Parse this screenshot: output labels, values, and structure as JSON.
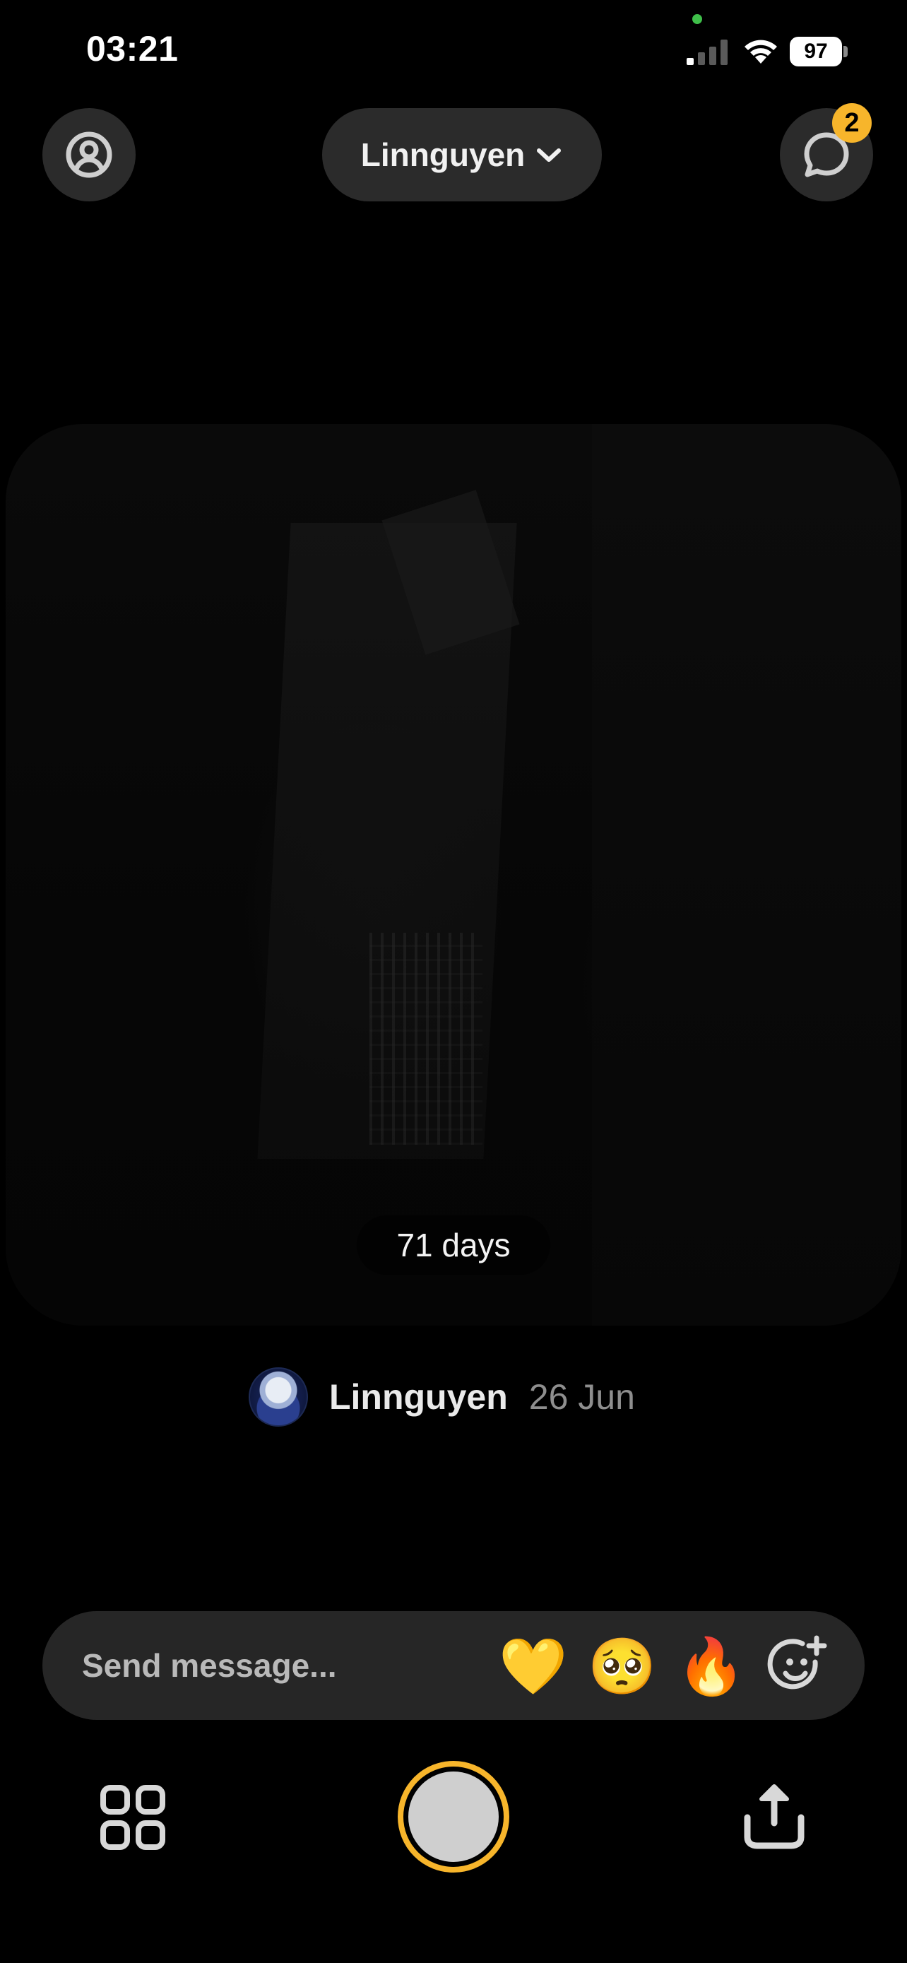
{
  "status_bar": {
    "time": "03:21",
    "battery": "97",
    "icons": [
      "signal-icon",
      "wifi-icon",
      "battery-icon"
    ]
  },
  "header": {
    "profile_icon": "user-circle-icon",
    "friend_selector_label": "Linnguyen",
    "selector_icon": "chevron-down-icon",
    "chat_icon": "chat-bubble-icon",
    "chat_badge_count": "2"
  },
  "photo": {
    "streak_label": "71 days"
  },
  "post_meta": {
    "poster_name": "Linnguyen",
    "date": "26 Jun"
  },
  "message_bar": {
    "placeholder": "Send message...",
    "reactions": [
      "💛",
      "🥺",
      "🔥"
    ],
    "add_reaction_icon": "smiley-plus-icon"
  },
  "bottom_bar": {
    "grid_icon": "grid-icon",
    "shutter_icon": "shutter-button",
    "share_icon": "share-upload-icon"
  },
  "colors": {
    "background": "#000000",
    "accent": "#f7b52b",
    "surface": "#2b2b2b"
  }
}
